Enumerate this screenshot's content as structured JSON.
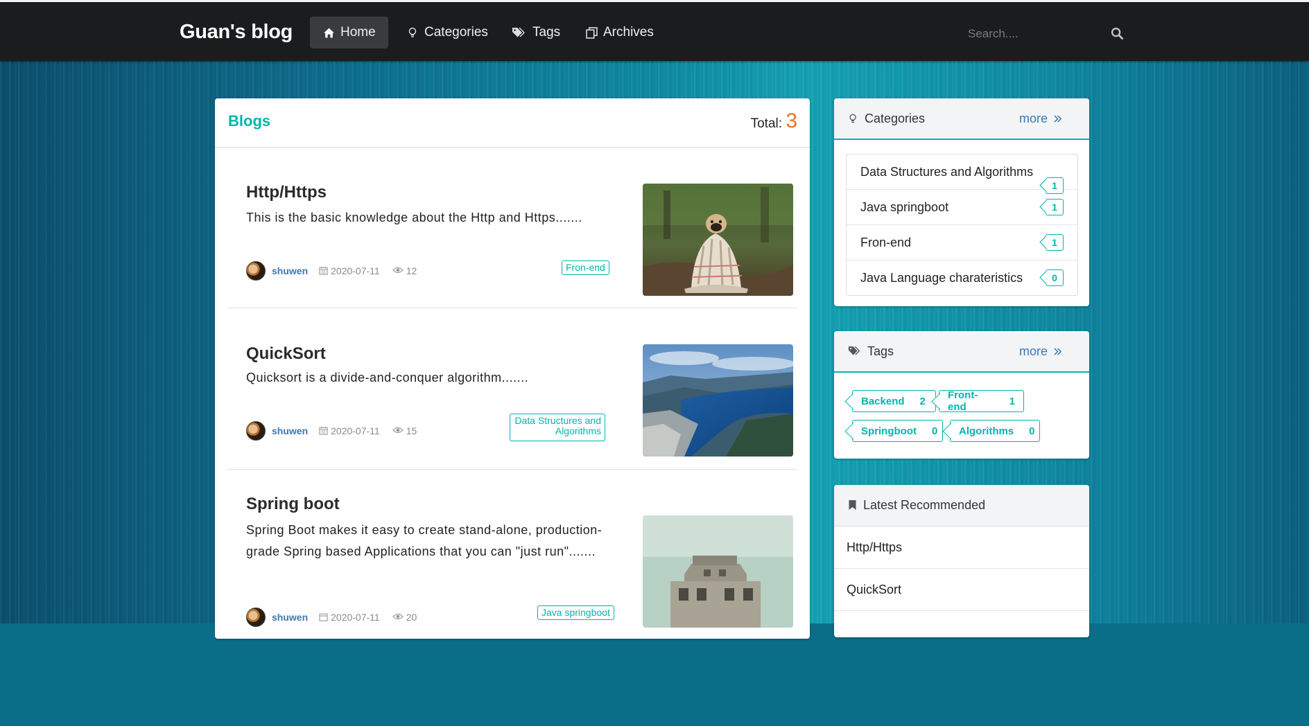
{
  "brand": "Guan's blog",
  "nav": [
    {
      "label": "Home",
      "icon": "home-icon",
      "active": true
    },
    {
      "label": "Categories",
      "icon": "lightbulb-icon",
      "active": false
    },
    {
      "label": "Tags",
      "icon": "tags-icon",
      "active": false
    },
    {
      "label": "Archives",
      "icon": "clone-icon",
      "active": false
    }
  ],
  "search": {
    "placeholder": "Search...."
  },
  "blogs": {
    "title": "Blogs",
    "total_label": "Total:",
    "total": "3",
    "posts": [
      {
        "title": "Http/Https",
        "desc": "This is the basic knowledge about the Http and Https.......",
        "author": "shuwen",
        "date": "2020-07-11",
        "views": "12",
        "tag": "Fron-end",
        "image": "pug-in-blanket"
      },
      {
        "title": "QuickSort",
        "desc": "Quicksort is a divide-and-conquer algorithm.......",
        "author": "shuwen",
        "date": "2020-07-11",
        "views": "15",
        "tag": "Data Structures and Algorithms",
        "image": "fjord-landscape"
      },
      {
        "title": "Spring boot",
        "desc": "Spring Boot makes it easy to create stand-alone, production-grade Spring based Applications that you can \"just run\".......",
        "author": "shuwen",
        "date": "2020-07-11",
        "views": "20",
        "tag": "Java springboot",
        "image": "concrete-bunker"
      }
    ]
  },
  "categories": {
    "title": "Categories",
    "more": "more",
    "items": [
      {
        "name": "Data Structures and Algorithms",
        "count": "1"
      },
      {
        "name": "Java springboot",
        "count": "1"
      },
      {
        "name": "Fron-end",
        "count": "1"
      },
      {
        "name": "Java Language charateristics",
        "count": "0"
      }
    ]
  },
  "tags": {
    "title": "Tags",
    "more": "more",
    "items": [
      {
        "name": "Backend",
        "count": "2"
      },
      {
        "name": "Front-end",
        "count": "1"
      },
      {
        "name": "Springboot",
        "count": "0"
      },
      {
        "name": "Algorithms",
        "count": "0"
      }
    ]
  },
  "recommended": {
    "title": "Latest Recommended",
    "items": [
      "Http/Https",
      "QuickSort"
    ]
  },
  "colors": {
    "accent_teal": "#00b5ad",
    "link_blue": "#3a78b5",
    "total_orange": "#f2711c",
    "navbar": "#1b1c1d"
  }
}
